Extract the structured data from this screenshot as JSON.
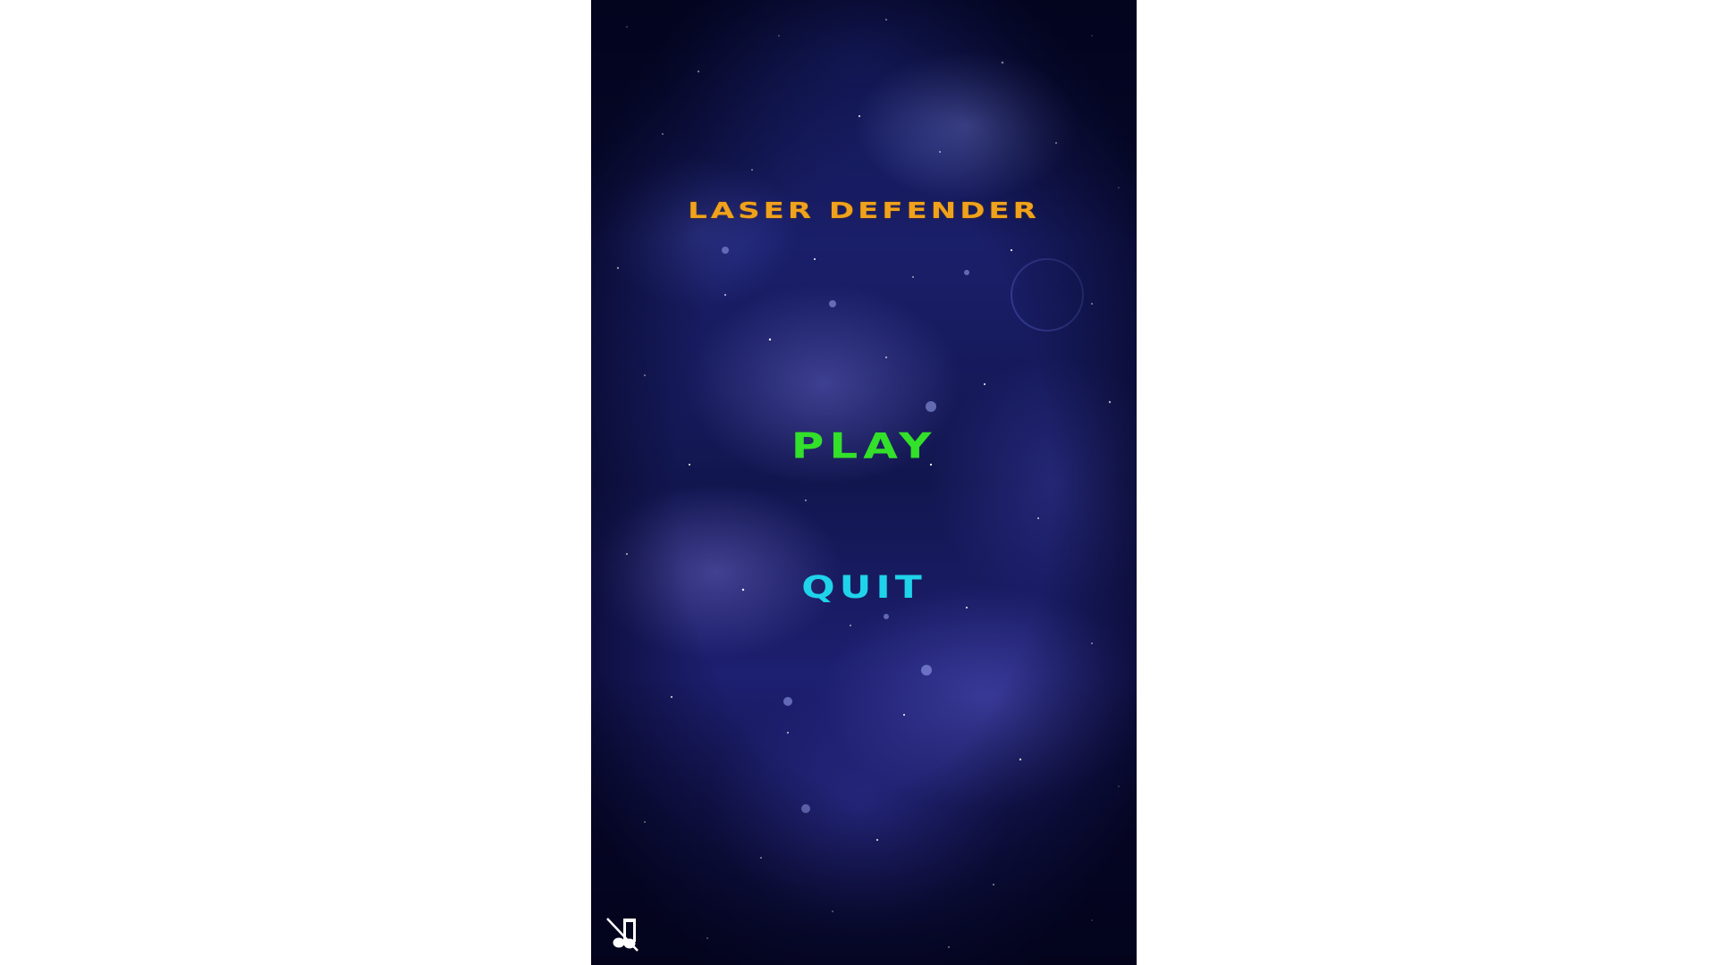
{
  "game": {
    "title": "Laser Defender",
    "menu": {
      "play_label": "Play",
      "quit_label": "Quit"
    },
    "music_toggle": {
      "icon": "music-muted-icon",
      "state": "muted"
    }
  },
  "colors": {
    "title": "#f0a21c",
    "play": "#33e02a",
    "quit": "#1fd3ea",
    "background": "#12164f",
    "icon": "#ffffff"
  }
}
